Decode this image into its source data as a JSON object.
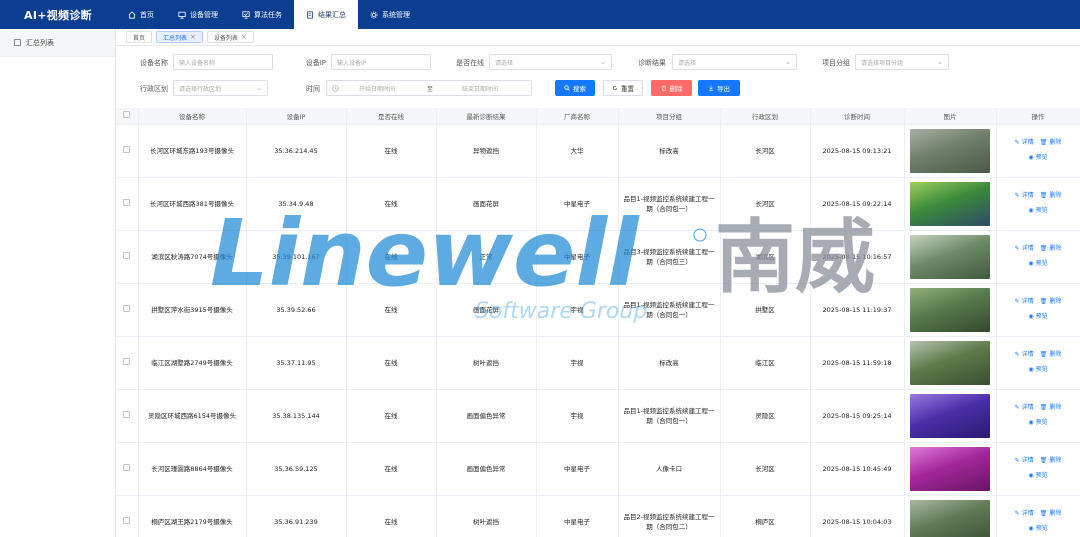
{
  "app": {
    "title": "AI+视频诊断"
  },
  "topnav": [
    {
      "label": "首页",
      "icon": "home-icon",
      "active": false
    },
    {
      "label": "设备管理",
      "icon": "monitor-icon",
      "active": false
    },
    {
      "label": "算法任务",
      "icon": "task-icon",
      "active": false
    },
    {
      "label": "结果汇总",
      "icon": "document-icon",
      "active": true
    },
    {
      "label": "系统管理",
      "icon": "gear-icon",
      "active": false
    }
  ],
  "sidebar": {
    "items": [
      {
        "label": "汇总列表"
      }
    ]
  },
  "tabs": [
    {
      "label": "首页",
      "closable": false,
      "active": false
    },
    {
      "label": "汇总列表",
      "closable": true,
      "active": true
    },
    {
      "label": "设备列表",
      "closable": true,
      "active": false
    }
  ],
  "filters": {
    "device_name": {
      "label": "设备名称",
      "placeholder": "输入设备名称"
    },
    "device_ip": {
      "label": "设备IP",
      "placeholder": "输入设备IP"
    },
    "online": {
      "label": "是否在线",
      "placeholder": "请选择"
    },
    "result": {
      "label": "诊断结果",
      "placeholder": "请选择"
    },
    "group": {
      "label": "项目分组",
      "placeholder": "请选择项目分组"
    },
    "region": {
      "label": "行政区划",
      "placeholder": "请选择行政区划"
    },
    "time": {
      "label": "时间",
      "start_placeholder": "开始日期时间",
      "separator": "至",
      "end_placeholder": "结束日期时间"
    }
  },
  "buttons": {
    "search": "搜索",
    "reset": "重置",
    "delete": "删除",
    "export": "导出"
  },
  "table": {
    "columns": [
      "设备名称",
      "设备IP",
      "是否在线",
      "最新诊断结果",
      "厂商名称",
      "项目分组",
      "行政区划",
      "诊断时间",
      "图片",
      "操作"
    ],
    "ops": {
      "detail": "详情",
      "delete": "删除",
      "preview": "预览"
    },
    "rows": [
      {
        "name": "长河区环城东路193号摄像头",
        "ip": "35.36.214.45",
        "online": "在线",
        "result": "异物遮挡",
        "vendor": "大华",
        "group": "标改高",
        "region": "长河区",
        "time": "2025-08-15 09:13:21",
        "thumb": [
          "#6f7d6a",
          "#a8b0a4",
          "#4b5a47"
        ]
      },
      {
        "name": "长河区环城西路381号摄像头",
        "ip": "35.34.9.48",
        "online": "在线",
        "result": "画面花屏",
        "vendor": "中星电子",
        "group": "品目1-视频监控系统续建工程一期（合同包一）",
        "region": "长河区",
        "time": "2025-08-15 09:22:14",
        "thumb": [
          "#3b8a3a",
          "#9fcf5e",
          "#2e4a6a"
        ]
      },
      {
        "name": "湖滨区秋涛路7074号摄像头",
        "ip": "35.39.101.167",
        "online": "在线",
        "result": "正常",
        "vendor": "中星电子",
        "group": "品目3-视频监控系统续建工程一期（合同包三）",
        "region": "湖滨区",
        "time": "2025-08-15 10:16:57",
        "thumb": [
          "#6d8b67",
          "#c7d2c2",
          "#3f5a3c"
        ]
      },
      {
        "name": "拱墅区萍水街3915号摄像头",
        "ip": "35.39.52.66",
        "online": "在线",
        "result": "画面花屏",
        "vendor": "宇视",
        "group": "品目1-视频监控系统续建工程一期（合同包一）",
        "region": "拱墅区",
        "time": "2025-08-15 11:19:37",
        "thumb": [
          "#567a4c",
          "#8fb07a",
          "#34482d"
        ]
      },
      {
        "name": "临江区湖墅路2749号摄像头",
        "ip": "35.37.11.95",
        "online": "在线",
        "result": "树叶遮挡",
        "vendor": "宇视",
        "group": "标改高",
        "region": "临江区",
        "time": "2025-08-15 11:59:18",
        "thumb": [
          "#5c7b4a",
          "#b6c2b0",
          "#3a4d30"
        ]
      },
      {
        "name": "灵隐区环城西路6154号摄像头",
        "ip": "35.38.135.144",
        "online": "在线",
        "result": "画面偏色异常",
        "vendor": "宇视",
        "group": "品目1-视频监控系统续建工程一期（合同包一）",
        "region": "灵隐区",
        "time": "2025-08-15 09:25:14",
        "thumb": [
          "#4a2fa8",
          "#9a7ae0",
          "#2a1a70"
        ]
      },
      {
        "name": "长河区瑾園路8864号摄像头",
        "ip": "35.36.59.125",
        "online": "在线",
        "result": "画面偏色异常",
        "vendor": "中星电子",
        "group": "人像卡口",
        "region": "长河区",
        "time": "2025-08-15 10:45:49",
        "thumb": [
          "#a2279a",
          "#e07ad8",
          "#6a1566"
        ]
      },
      {
        "name": "桐庐区湖王路2179号摄像头",
        "ip": "35.36.91.239",
        "online": "在线",
        "result": "树叶遮挡",
        "vendor": "中星电子",
        "group": "品目2-视频监控系统续建工程一期（合同包二）",
        "region": "桐庐区",
        "time": "2025-08-15 10:04:03",
        "thumb": [
          "#5f7a55",
          "#a9b8a0",
          "#3b5033"
        ]
      }
    ]
  },
  "watermark": {
    "brand": "Linewell",
    "brand_cn": "南威",
    "sub": "Software Group"
  },
  "colors": {
    "topbar": "#0b3d91",
    "primary": "#1677ff",
    "danger": "#ff6b6b",
    "watermark": "#1f8bd6"
  }
}
